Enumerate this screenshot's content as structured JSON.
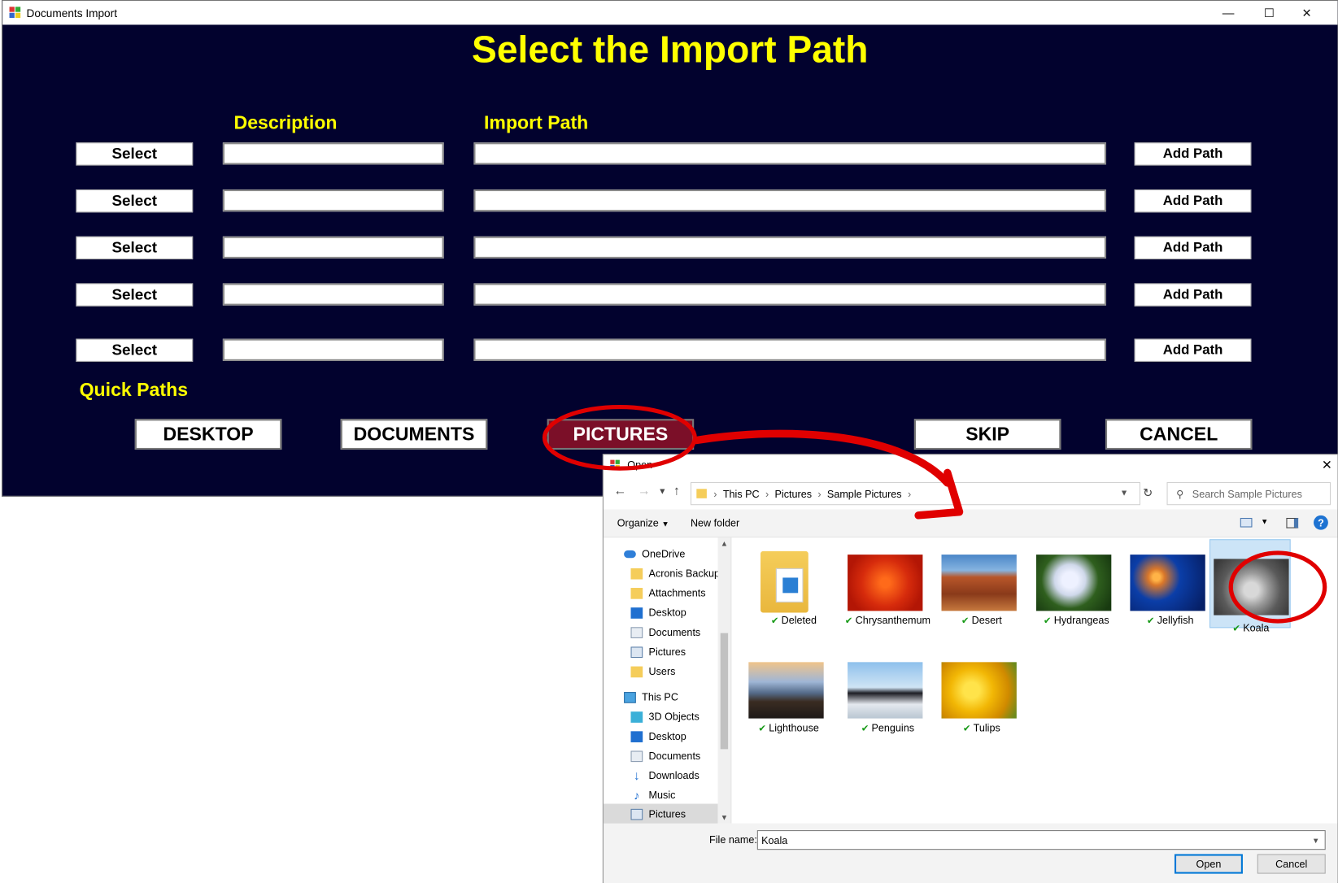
{
  "window": {
    "title": "Documents Import",
    "heading": "Select the Import Path",
    "col_description": "Description",
    "col_import_path": "Import Path",
    "select_label": "Select",
    "add_path_label": "Add Path",
    "rows": [
      {
        "description": "",
        "path": ""
      },
      {
        "description": "",
        "path": ""
      },
      {
        "description": "",
        "path": ""
      },
      {
        "description": "",
        "path": ""
      },
      {
        "description": "",
        "path": ""
      }
    ],
    "quick_paths_label": "Quick Paths",
    "quick_buttons": [
      "DESKTOP",
      "DOCUMENTS",
      "PICTURES"
    ],
    "active_quick_button": "PICTURES",
    "skip_label": "SKIP",
    "cancel_label": "CANCEL"
  },
  "dialog": {
    "title": "Open",
    "breadcrumb": [
      "This PC",
      "Pictures",
      "Sample Pictures"
    ],
    "search_placeholder": "Search Sample Pictures",
    "organize_label": "Organize",
    "new_folder_label": "New folder",
    "tree_group1": [
      "OneDrive",
      "Acronis Backup",
      "Attachments",
      "Desktop",
      "Documents",
      "Pictures",
      "Users"
    ],
    "tree_group2": [
      "This PC",
      "3D Objects",
      "Desktop",
      "Documents",
      "Downloads",
      "Music",
      "Pictures"
    ],
    "files_row1": [
      "Deleted",
      "Chrysanthemum",
      "Desert",
      "Hydrangeas",
      "Jellyfish",
      "Koala"
    ],
    "files_row2": [
      "Lighthouse",
      "Penguins",
      "Tulips"
    ],
    "selected_file": "Koala",
    "file_name_label": "File name:",
    "file_name_value": "Koala",
    "open_label": "Open",
    "cancel_label": "Cancel"
  },
  "colors": {
    "background": "#02022e",
    "heading": "#ffff00",
    "active_button": "#7b0f28",
    "annotation": "#e00000"
  }
}
